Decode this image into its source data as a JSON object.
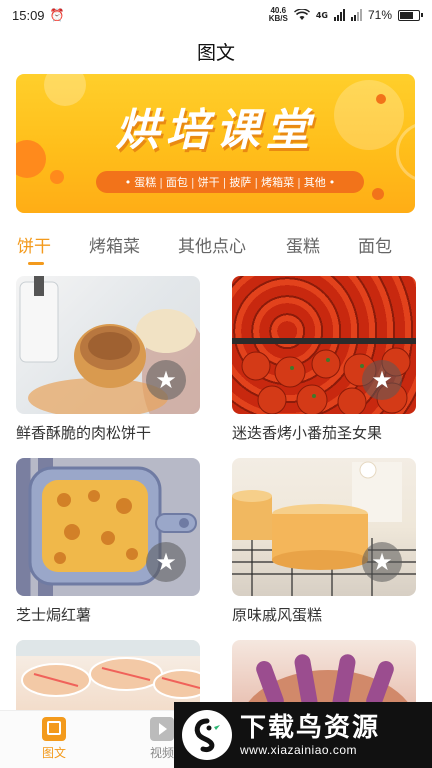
{
  "status_bar": {
    "time": "15:09",
    "net_speed_value": "40.6",
    "net_speed_unit": "KB/S",
    "network_type": "4G",
    "battery_percent": "71%",
    "battery_level": 0.71
  },
  "header": {
    "title": "图文"
  },
  "banner": {
    "title": "烘培课堂",
    "categories": [
      "蛋糕",
      "面包",
      "饼干",
      "披萨",
      "烤箱菜",
      "其他"
    ],
    "colors": {
      "background": "#ffc21f",
      "pill": "#f2731a"
    }
  },
  "tabs": [
    {
      "label": "饼干",
      "active": true
    },
    {
      "label": "烤箱菜",
      "active": false
    },
    {
      "label": "其他点心",
      "active": false
    },
    {
      "label": "蛋糕",
      "active": false
    },
    {
      "label": "面包",
      "active": false
    }
  ],
  "recipes": [
    {
      "title": "鲜香酥脆的肉松饼干",
      "image": "pork-floss-cookie-photo"
    },
    {
      "title": "迷迭香烤小番茄圣女果",
      "image": "roasted-cherry-tomatoes-photo"
    },
    {
      "title": "芝士焗红薯",
      "image": "cheese-baked-sweet-potato-photo"
    },
    {
      "title": "原味戚风蛋糕",
      "image": "chiffon-cake-photo"
    },
    {
      "title": "",
      "image": "bread-photo"
    },
    {
      "title": "",
      "image": "purple-pastry-photo"
    }
  ],
  "bottom_nav": [
    {
      "label": "图文",
      "icon": "book-icon",
      "active": true
    },
    {
      "label": "视频",
      "icon": "video-icon",
      "active": false
    }
  ],
  "watermark": {
    "title": "下载鸟资源",
    "url": "www.xiazainiao.com"
  },
  "accent_color": "#f39a1c"
}
